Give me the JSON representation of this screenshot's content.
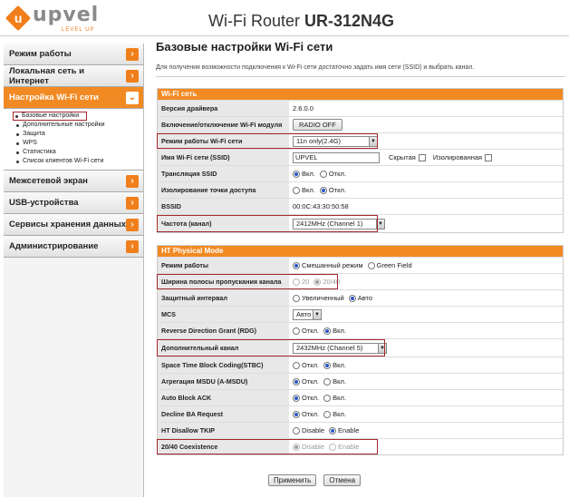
{
  "header": {
    "logo_letter": "u",
    "logo_text": "upvel",
    "logo_sub": "LEVEL UP",
    "title_plain": "Wi-Fi Router ",
    "title_bold": "UR-312N4G"
  },
  "sidebar": {
    "items": [
      {
        "label": "Режим работы"
      },
      {
        "label": "Локальная сеть и Интернет"
      },
      {
        "label": "Настройка Wi-Fi сети"
      },
      {
        "label": "Межсетевой экран"
      },
      {
        "label": "USB-устройства"
      },
      {
        "label": "Сервисы хранения данных"
      },
      {
        "label": "Администрирование"
      }
    ],
    "submenu": [
      "Базовые настройки",
      "Дополнительные настройки",
      "Защита",
      "WPS",
      "Статистика",
      "Список клиентов Wi-Fi сети"
    ]
  },
  "main": {
    "title": "Базовые настройки Wi-Fi сети",
    "description": "Для получения возможности подключения к Wi-Fi сети достаточно задать имя сети (SSID) и выбрать канал."
  },
  "wifi": {
    "heading": "Wi-Fi сеть",
    "driver_label": "Версия драйвера",
    "driver_value": "2.6.0.0",
    "toggle_label": "Включение/отключение Wi-Fi модуля",
    "toggle_button": "RADIO OFF",
    "mode_label": "Режим работы Wi-Fi сети",
    "mode_value": "11n only(2.4G)",
    "ssid_label": "Имя Wi-Fi сети (SSID)",
    "ssid_value": "UPVEL",
    "hidden_label": "Скрытая",
    "isolated_label": "Изолированная",
    "broadcast_label": "Трансляция SSID",
    "on": "Вкл.",
    "off": "Откл.",
    "ap_isolation_label": "Изолирование точки доступа",
    "bssid_label": "BSSID",
    "bssid_value": "00:0C:43:30:50:58",
    "channel_label": "Частота (канал)",
    "channel_value": "2412MHz (Channel 1)"
  },
  "ht": {
    "heading": "HT Physical Mode",
    "opmode_label": "Режим работы",
    "opmode_mixed": "Смешанный режим",
    "opmode_green": "Green Field",
    "bw_label": "Ширина полосы пропускания канала",
    "bw_20": "20",
    "bw_2040": "20/40",
    "gi_label": "Защитный интервал",
    "gi_long": "Увеличенный",
    "gi_auto": "Авто",
    "mcs_label": "MCS",
    "mcs_value": "Авто",
    "rdg_label": "Reverse Direction Grant (RDG)",
    "ext_label": "Дополнительный канал",
    "ext_value": "2432MHz (Channel 5)",
    "stbc_label": "Space Time Block Coding(STBC)",
    "amsdu_label": "Агрегация MSDU (A-MSDU)",
    "autoba_label": "Auto Block ACK",
    "declineba_label": "Decline BA Request",
    "tkip_label": "HT Disallow TKIP",
    "disable": "Disable",
    "enable": "Enable",
    "coex_label": "20/40 Coexistence"
  },
  "buttons": {
    "apply": "Применить",
    "cancel": "Отмена"
  }
}
